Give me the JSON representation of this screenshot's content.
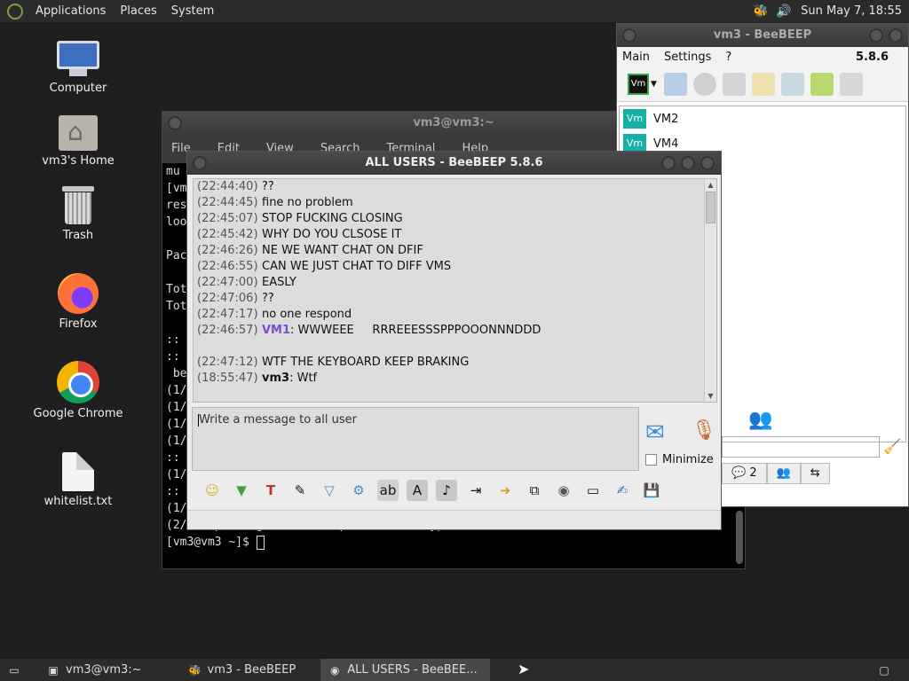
{
  "top_panel": {
    "menus": [
      "Applications",
      "Places",
      "System"
    ],
    "clock": "Sun May 7, 18:55",
    "icons": [
      "bee-icon",
      "volume-icon"
    ]
  },
  "desktop": {
    "icons": [
      {
        "label": "Computer",
        "icon": "computer-icon"
      },
      {
        "label": "vm3's Home",
        "icon": "home-folder-icon"
      },
      {
        "label": "Trash",
        "icon": "trash-icon"
      },
      {
        "label": "Firefox",
        "icon": "firefox-icon"
      },
      {
        "label": "Google Chrome",
        "icon": "chrome-icon"
      },
      {
        "label": "whitelist.txt",
        "icon": "text-file-icon"
      }
    ]
  },
  "terminal": {
    "title": "vm3@vm3:~",
    "menu": [
      "File",
      "Edit",
      "View",
      "Search",
      "Terminal",
      "Help"
    ],
    "lines": [
      "mu",
      "[vm",
      "res",
      "loo",
      "",
      "Pac",
      "",
      "Tot",
      "Tot",
      "",
      ":: ",
      ":: ",
      " bee",
      "(1/",
      "(1/",
      "(1/",
      "(1/",
      ":: ",
      "(1/",
      ":: ",
      "(1/"
    ],
    "last_output": "(2/2) Updating the desktop file MIME type cache...",
    "prompt": "[vm3@vm3 ~]$ "
  },
  "beebeep_main": {
    "title": "vm3 - BeeBEEP",
    "menu": [
      "Main",
      "Settings",
      "?"
    ],
    "version": "5.8.6",
    "status_button": "Vm",
    "users": [
      {
        "badge": "Vm",
        "name": "VM2"
      },
      {
        "badge": "Vm",
        "name": "VM4"
      }
    ],
    "tab_count": "2",
    "colors": {
      "badge": "#16b0a8"
    }
  },
  "chat": {
    "title": "ALL USERS - BeeBEEP 5.8.6",
    "messages": [
      {
        "time": "(22:44:40)",
        "sender": "",
        "text": "??"
      },
      {
        "time": "(22:44:45)",
        "sender": "",
        "text": "fine no problem"
      },
      {
        "time": "(22:45:07)",
        "sender": "",
        "text": "STOP FUCKING CLOSING"
      },
      {
        "time": "(22:45:42)",
        "sender": "",
        "text": "WHY DO YOU CLSOSE IT"
      },
      {
        "time": "(22:46:26)",
        "sender": "",
        "text": "NE WE WANT CHAT ON DFIF"
      },
      {
        "time": "(22:46:55)",
        "sender": "",
        "text": "CAN WE JUST CHAT TO DIFF VMS"
      },
      {
        "time": "(22:47:00)",
        "sender": "",
        "text": "EASLY"
      },
      {
        "time": "(22:47:06)",
        "sender": "",
        "text": "??"
      },
      {
        "time": "(22:47:17)",
        "sender": "",
        "text": "no one respond"
      },
      {
        "time": "(22:46:57)",
        "sender": "VM1",
        "text": ": WWWEEE     RRREEESSSPPPOOONNNDDD"
      },
      {
        "time": "",
        "sender": "",
        "text": ""
      },
      {
        "time": "(22:47:12)",
        "sender": "",
        "text": "WTF THE KEYBOARD KEEP BRAKING"
      },
      {
        "time": "(18:55:47)",
        "sender": "vm3",
        "text": ": Wtf"
      }
    ],
    "input_placeholder": "Write a message to all user",
    "minimize_label": "Minimize",
    "colors": {
      "vm1_sender": "#7a4fd0"
    }
  },
  "taskbar": {
    "items": [
      {
        "label": "vm3@vm3:~",
        "icon": "terminal-icon",
        "active": false
      },
      {
        "label": "vm3 - BeeBEEP",
        "icon": "bee-icon",
        "active": false
      },
      {
        "label": "ALL USERS - BeeBEE...",
        "icon": "chat-icon",
        "active": true
      }
    ]
  }
}
